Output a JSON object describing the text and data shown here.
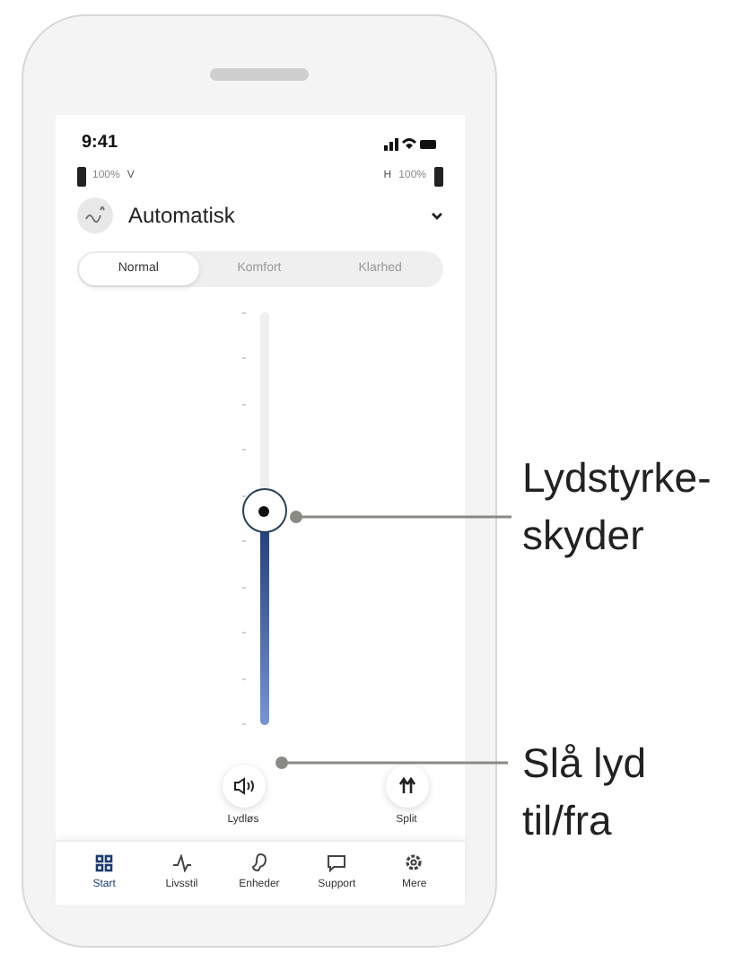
{
  "status_bar": {
    "time": "9:41"
  },
  "batteries": {
    "left": {
      "percent": "100%",
      "side": "V"
    },
    "right": {
      "percent": "100%",
      "side": "H"
    }
  },
  "program": {
    "name": "Automatisk"
  },
  "modes": [
    {
      "label": "Normal",
      "selected": true
    },
    {
      "label": "Komfort",
      "selected": false
    },
    {
      "label": "Klarhed",
      "selected": false
    }
  ],
  "volume": {
    "level": 0.52
  },
  "buttons": [
    {
      "label": "Lydløs",
      "kind": "mute"
    },
    {
      "label": "Split",
      "kind": "split"
    }
  ],
  "nav": [
    {
      "label": "Start",
      "kind": "home",
      "selected": true
    },
    {
      "label": "Livsstil",
      "kind": "lifestyle",
      "selected": false
    },
    {
      "label": "Enheder",
      "kind": "devices",
      "selected": false
    },
    {
      "label": "Support",
      "kind": "support",
      "selected": false
    },
    {
      "label": "Mere",
      "kind": "more",
      "selected": false
    }
  ],
  "callouts": [
    {
      "text": "Lydstyrke-\nskyder"
    },
    {
      "text": "Slå lyd\ntil/fra"
    }
  ]
}
